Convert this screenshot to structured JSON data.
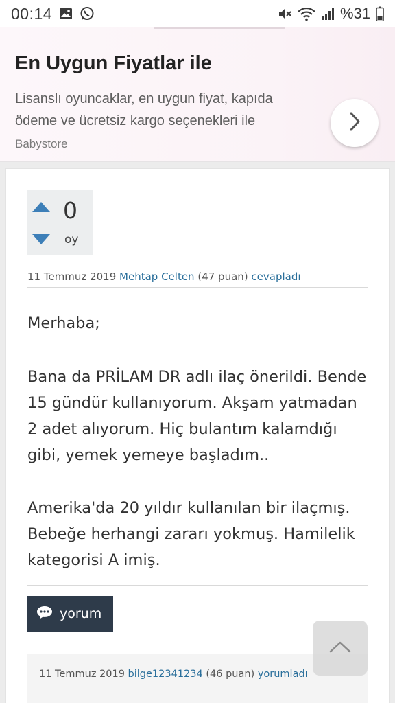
{
  "status_bar": {
    "time": "00:14",
    "battery_percent": "%31",
    "icons": [
      "image-icon",
      "whatsapp-icon",
      "mute-icon",
      "wifi-icon",
      "signal-icon",
      "battery-icon"
    ]
  },
  "ad": {
    "title": "En Uygun Fiyatlar ile",
    "description": "Lisanslı oyuncaklar, en uygun fiyat, kapıda ödeme ve ücretsiz kargo seçenekleri ile",
    "source": "Babystore",
    "arrow_icon": "chevron-right-icon"
  },
  "answer": {
    "vote_count": "0",
    "vote_label": "oy",
    "meta": {
      "date": "11 Temmuz 2019",
      "author": "Mehtap Celten",
      "points": "(47 puan)",
      "action": "cevapladı"
    },
    "paragraphs": [
      "Merhaba;",
      "Bana da PRİLAM DR adlı ilaç önerildi. Bende 15 gündür kullanıyorum. Akşam yatmadan 2 adet alıyorum. Hiç bulantım kalamdığı gibi, yemek yemeye başladım..",
      "Amerika'da 20 yıldır kullanılan bir ilaçmış. Bebeğe herhangi zararı yokmuş. Hamilelik kategorisi A imiş."
    ],
    "comment_button_label": "yorum"
  },
  "comment": {
    "date": "11 Temmuz 2019",
    "author": "bilge12341234",
    "points": "(46 puan)",
    "action": "yorumladı"
  },
  "colors": {
    "link": "#2a6f9b",
    "vote_arrow": "#3d7fb8",
    "button_bg": "#2e3b4a"
  }
}
